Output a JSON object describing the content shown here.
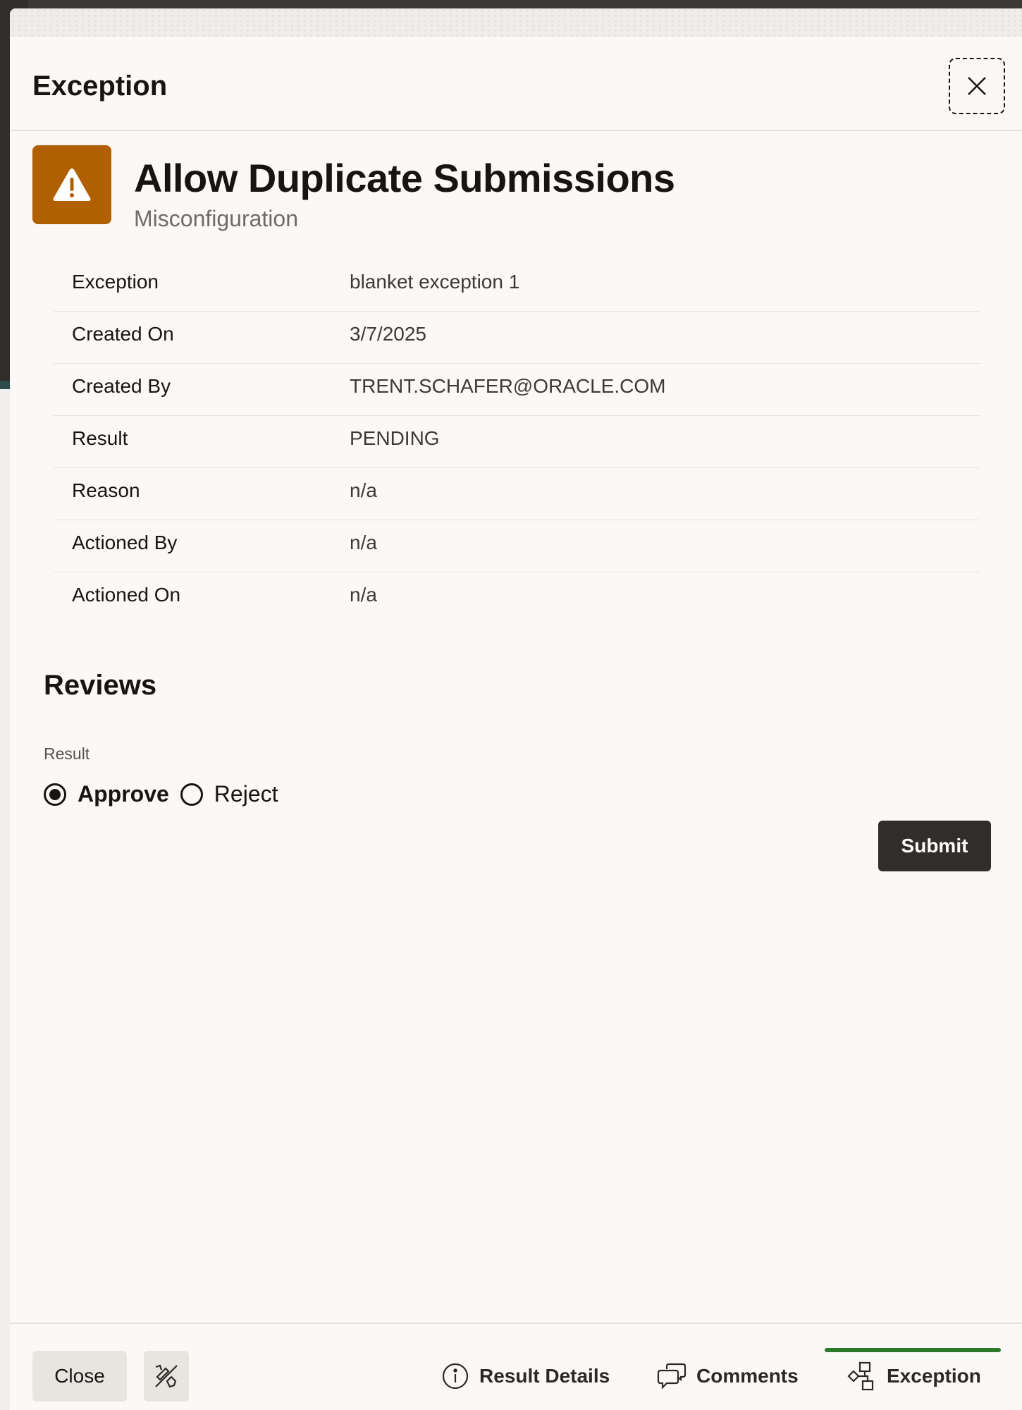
{
  "header": {
    "title": "Exception"
  },
  "hero": {
    "title": "Allow Duplicate Submissions",
    "subtitle": "Misconfiguration",
    "icon": "warning-icon",
    "icon_color": "#b06000"
  },
  "details": [
    {
      "label": "Exception",
      "value": "blanket exception 1"
    },
    {
      "label": "Created On",
      "value": "3/7/2025"
    },
    {
      "label": "Created By",
      "value": "TRENT.SCHAFER@ORACLE.COM"
    },
    {
      "label": "Result",
      "value": "PENDING"
    },
    {
      "label": "Reason",
      "value": "n/a"
    },
    {
      "label": "Actioned By",
      "value": "n/a"
    },
    {
      "label": "Actioned On",
      "value": "n/a"
    }
  ],
  "reviews": {
    "title": "Reviews",
    "result_label": "Result",
    "options": [
      {
        "label": "Approve",
        "selected": true
      },
      {
        "label": "Reject",
        "selected": false
      }
    ],
    "submit_label": "Submit"
  },
  "footer": {
    "close_label": "Close",
    "tabs": [
      {
        "label": "Result Details",
        "icon": "info-icon",
        "active": false
      },
      {
        "label": "Comments",
        "icon": "comments-icon",
        "active": false
      },
      {
        "label": "Exception",
        "icon": "hierarchy-icon",
        "active": true
      }
    ],
    "active_color": "#2a7a2a"
  }
}
